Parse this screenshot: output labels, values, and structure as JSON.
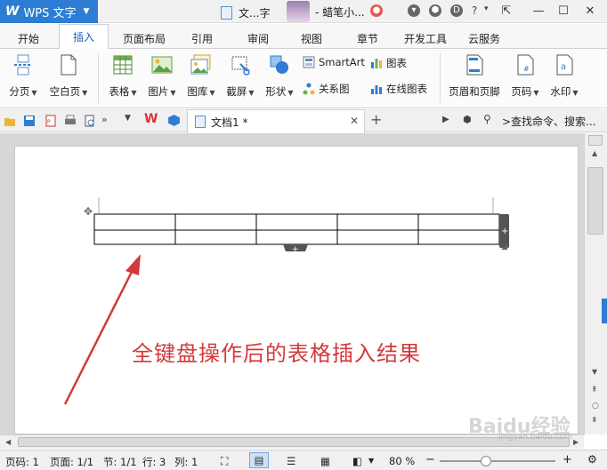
{
  "titlebar": {
    "app_name": "WPS 文字",
    "doc_tab": "文...字",
    "user_name": "- 蜡笔小...",
    "help": "?"
  },
  "menu": {
    "tabs": [
      "开始",
      "插入",
      "页面布局",
      "引用",
      "审阅",
      "视图",
      "章节",
      "开发工具",
      "云服务"
    ],
    "active_tab": "插入"
  },
  "ribbon": {
    "page_break": "分页",
    "blank_page": "空白页",
    "table": "表格",
    "picture": "图片",
    "gallery": "图库",
    "screenshot": "截屏",
    "shape": "形状",
    "smartart": "SmartArt",
    "chart": "图表",
    "relation": "关系图",
    "online_chart": "在线图表",
    "header_footer": "页眉和页脚",
    "page_number": "页码",
    "watermark": "水印"
  },
  "document": {
    "tab_title": "文档1 *",
    "new_tab": "+",
    "search_placeholder": ">查找命令、搜索...",
    "caption": "全键盘操作后的表格插入结果"
  },
  "statusbar": {
    "page_num": "页码: 1",
    "pages": "页面: 1/1",
    "section": "节: 1/1",
    "line": "行: 3",
    "column": "列: 1",
    "zoom": "80 %"
  },
  "watermark": {
    "brand": "Baidu经验",
    "url": "jingyan.baidu.com"
  },
  "colors": {
    "accent": "#2c7dd3",
    "caption": "#d3393a",
    "arrow": "#d3393a"
  },
  "table": {
    "rows": 2,
    "cols": 5
  }
}
